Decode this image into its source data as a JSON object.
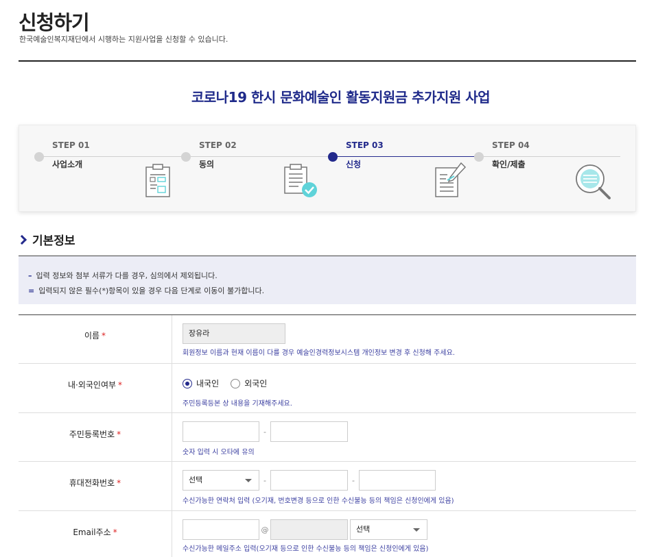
{
  "header": {
    "title": "신청하기",
    "subtitle": "한국예술인복지재단에서 시행하는 지원사업을 신청할 수 있습니다."
  },
  "program_title": "코로나19 한시 문화예술인 활동지원금 추가지원 사업",
  "steps": [
    {
      "num": "STEP 01",
      "name": "사업소개",
      "icon": "clipboard-form-icon",
      "active": false
    },
    {
      "num": "STEP 02",
      "name": "동의",
      "icon": "clipboard-check-icon",
      "active": false
    },
    {
      "num": "STEP 03",
      "name": "신청",
      "icon": "document-edit-icon",
      "active": true
    },
    {
      "num": "STEP 04",
      "name": "확인/제출",
      "icon": "magnifier-icon",
      "active": false
    }
  ],
  "section": {
    "title": "기본정보"
  },
  "notice": [
    "입력 정보와 첨부 서류가 다를 경우, 심의에서 제외됩니다.",
    "입력되지 않은 필수(*)항목이 있을 경우 다음 단계로 이동이 불가합니다."
  ],
  "colors": {
    "accent": "#232a8c",
    "required": "#d22222",
    "notice_bg": "#ecedf6"
  },
  "form": {
    "required_mark": "*",
    "name": {
      "label": "이름",
      "value": "장유라",
      "hint": "회원정보 이름과 현재 이름이 다를 경우 예술인경력정보시스템 개인정보 변경 후 신청해 주세요."
    },
    "nationality": {
      "label": "내·외국인여부",
      "options": [
        "내국인",
        "외국인"
      ],
      "selected": "내국인",
      "hint": "주민등록등본 상 내용을 기재해주세요."
    },
    "resident_number": {
      "label": "주민등록번호",
      "part1": "",
      "part2": "",
      "separator": "-",
      "hint": "숫자 입력 시 오타에 유의"
    },
    "mobile": {
      "label": "휴대전화번호",
      "select_value": "선택",
      "part2": "",
      "part3": "",
      "separator": "-",
      "hint": "수신가능한 연락처 입력 (오기재, 번호변경 등으로 인한 수신불능 등의 책임은 신청인에게 있음)"
    },
    "email": {
      "label": "Email주소",
      "local": "",
      "at": "@",
      "domain": "",
      "select_value": "선택",
      "hint": "수신가능한 메일주소 입력(오기재 등으로 인한 수신불능 등의 책임은 신청인에게 있음)"
    }
  }
}
